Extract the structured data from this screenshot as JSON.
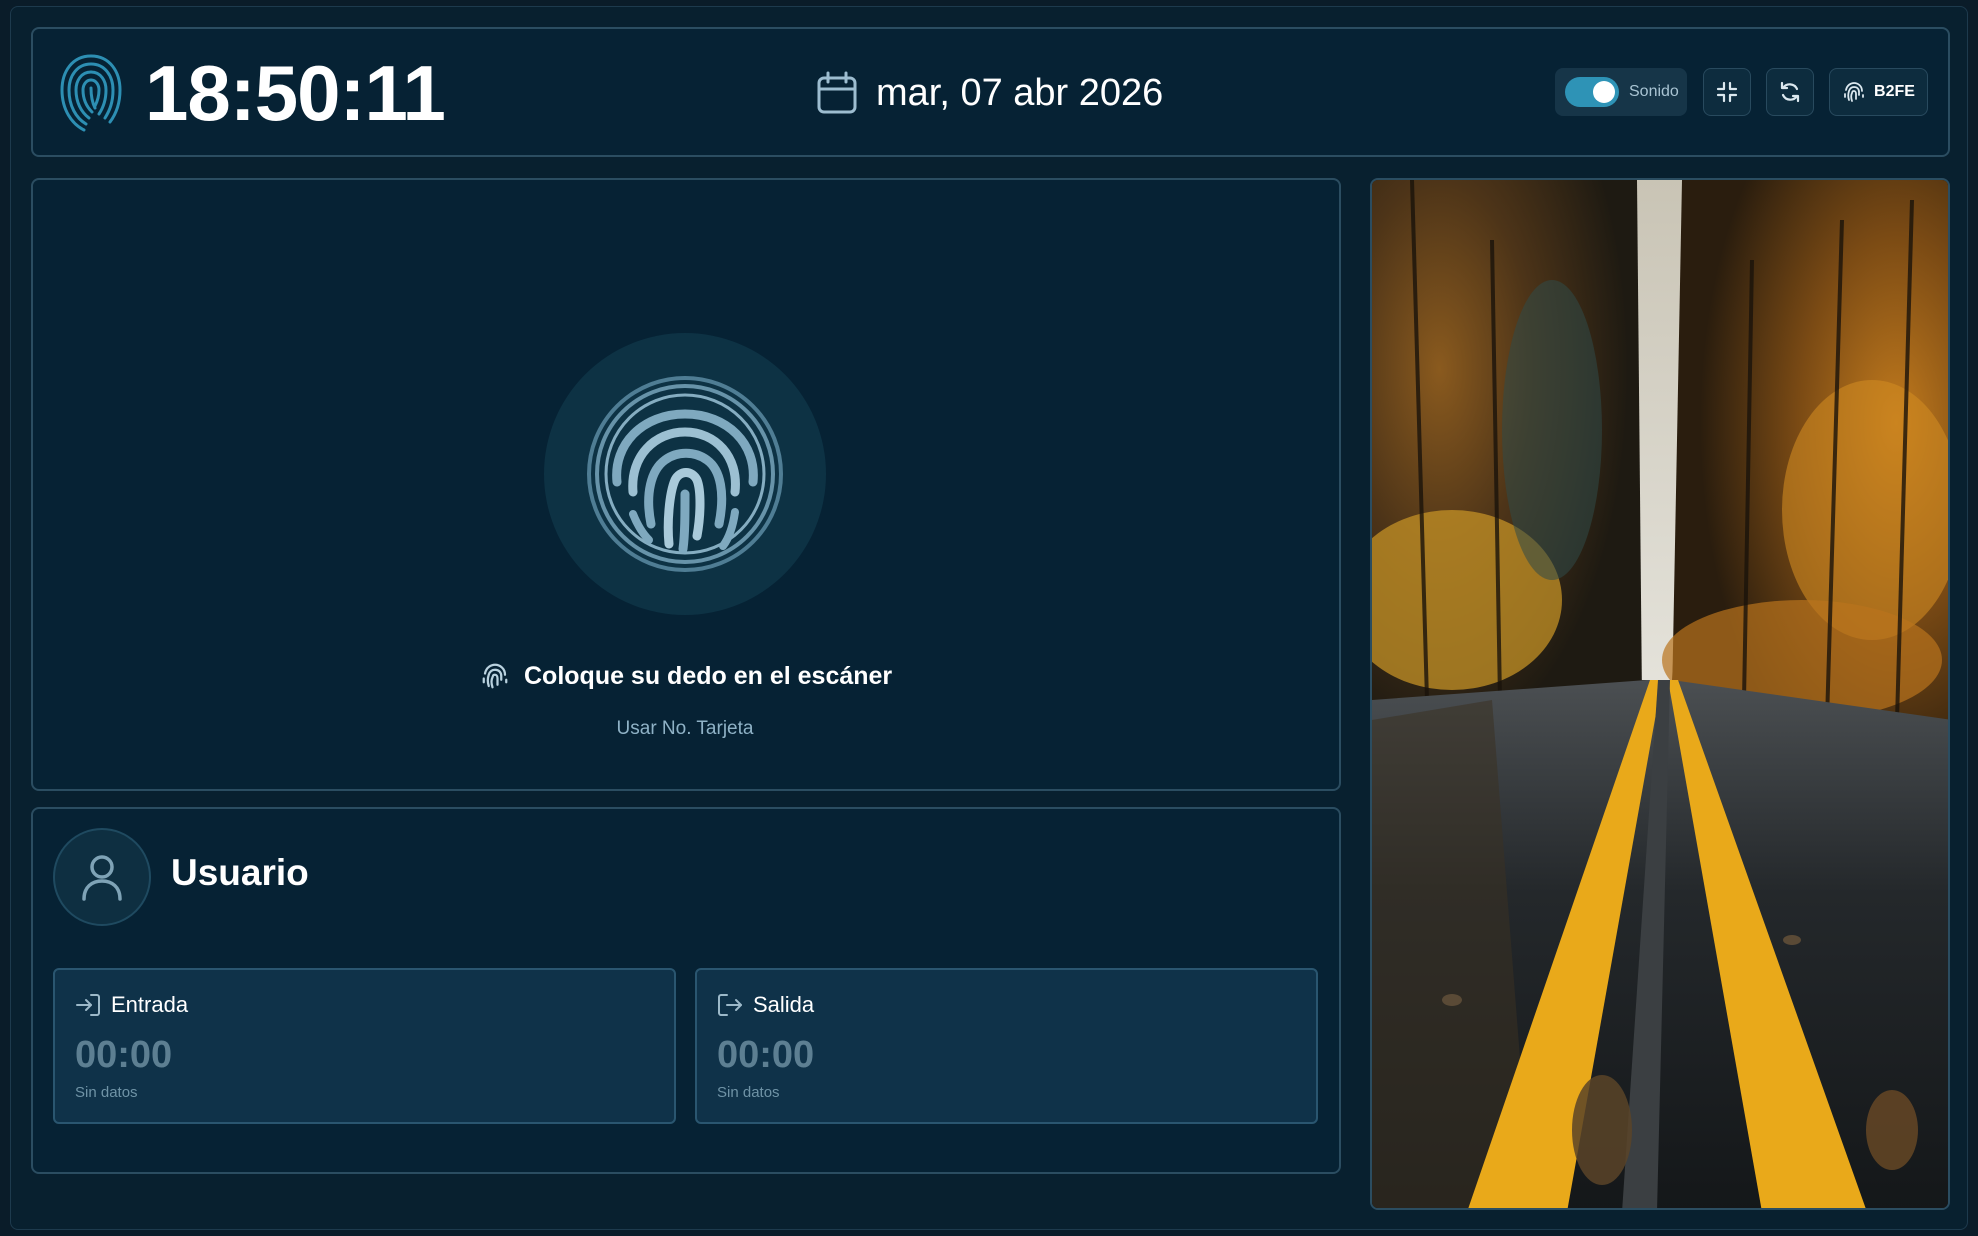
{
  "header": {
    "clock": "18:50:11",
    "date": "mar, 07 abr 2026",
    "sound_label": "Sonido",
    "sound_on": true,
    "device_label": "B2FE"
  },
  "scanner": {
    "prompt": "Coloque su dedo en el escáner",
    "card_link": "Usar No. Tarjeta"
  },
  "user": {
    "name": "Usuario",
    "entrada": {
      "label": "Entrada",
      "time": "00:00",
      "status": "Sin datos"
    },
    "salida": {
      "label": "Salida",
      "time": "00:00",
      "status": "Sin datos"
    }
  },
  "icons": [
    "fingerprint-logo-icon",
    "calendar-icon",
    "collapse-icon",
    "refresh-icon",
    "fingerprint-icon",
    "user-icon",
    "login-icon",
    "logout-icon"
  ],
  "colors": {
    "accent": "#2e93b6",
    "panel": "#062234",
    "border": "#2b4d61"
  }
}
